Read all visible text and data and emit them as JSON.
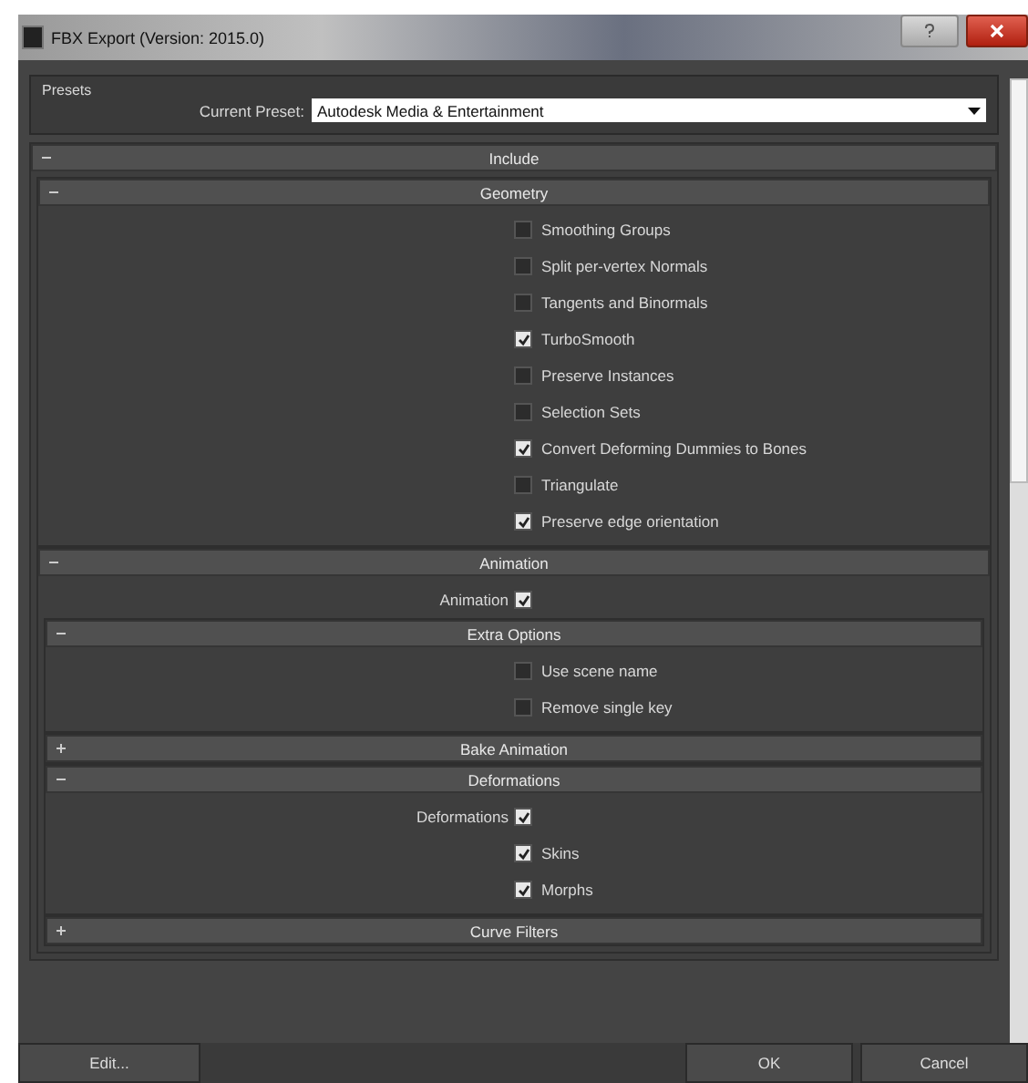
{
  "window": {
    "title": "FBX Export (Version: 2015.0)"
  },
  "presets": {
    "label": "Presets",
    "preset_label": "Current Preset:",
    "preset_value": "Autodesk Media & Entertainment"
  },
  "rollouts": [
    {
      "kind": "rollout",
      "title": "Include",
      "expanded": true,
      "children": [
        {
          "kind": "rollout",
          "title": "Geometry",
          "expanded": true,
          "children": [
            {
              "kind": "checkbox",
              "label": "Smoothing Groups",
              "checked": false
            },
            {
              "kind": "checkbox",
              "label": "Split per-vertex Normals",
              "checked": false
            },
            {
              "kind": "checkbox",
              "label": "Tangents and Binormals",
              "checked": false
            },
            {
              "kind": "checkbox",
              "label": "TurboSmooth",
              "checked": true
            },
            {
              "kind": "checkbox",
              "label": "Preserve Instances",
              "checked": false
            },
            {
              "kind": "checkbox",
              "label": "Selection Sets",
              "checked": false
            },
            {
              "kind": "checkbox",
              "label": "Convert Deforming Dummies to Bones",
              "checked": true
            },
            {
              "kind": "checkbox",
              "label": "Triangulate",
              "checked": false
            },
            {
              "kind": "checkbox",
              "label": "Preserve edge orientation",
              "checked": true
            }
          ]
        },
        {
          "kind": "rollout",
          "title": "Animation",
          "expanded": true,
          "children": [
            {
              "kind": "labeled_checkbox",
              "label": "Animation",
              "checked": true
            },
            {
              "kind": "rollout",
              "title": "Extra Options",
              "expanded": true,
              "children": [
                {
                  "kind": "checkbox",
                  "label": "Use scene name",
                  "checked": false
                },
                {
                  "kind": "checkbox",
                  "label": "Remove single key",
                  "checked": false
                }
              ]
            },
            {
              "kind": "rollout",
              "title": "Bake Animation",
              "expanded": false
            },
            {
              "kind": "rollout",
              "title": "Deformations",
              "expanded": true,
              "children": [
                {
                  "kind": "labeled_checkbox",
                  "label": "Deformations",
                  "checked": true
                },
                {
                  "kind": "checkbox",
                  "label": "Skins",
                  "checked": true
                },
                {
                  "kind": "checkbox",
                  "label": "Morphs",
                  "checked": true
                }
              ]
            },
            {
              "kind": "rollout",
              "title": "Curve Filters",
              "expanded": false
            }
          ]
        }
      ]
    }
  ],
  "buttons": [
    "Edit...",
    "OK",
    "Cancel"
  ]
}
